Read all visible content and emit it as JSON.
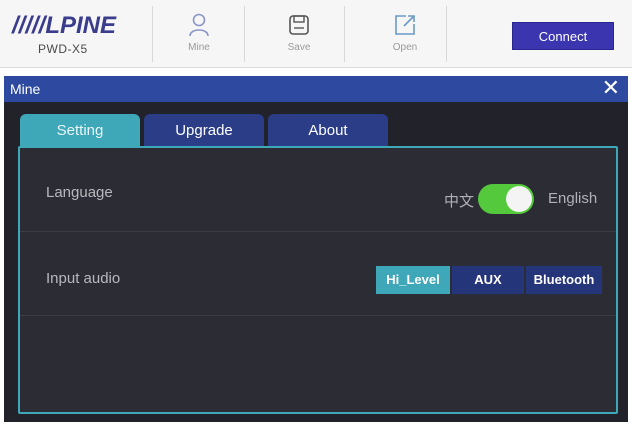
{
  "brand": {
    "logo_text": "/////LPINE",
    "model": "PWD-X5"
  },
  "toolbar": {
    "mine_label": "Mine",
    "save_label": "Save",
    "open_label": "Open",
    "connect_label": "Connect"
  },
  "dialog": {
    "title": "Mine",
    "close_symbol": "✕",
    "tabs": [
      {
        "label": "Setting",
        "active": true
      },
      {
        "label": "Upgrade",
        "active": false
      },
      {
        "label": "About",
        "active": false
      }
    ],
    "settings": {
      "language": {
        "label": "Language",
        "option_left": "中文",
        "option_right": "English",
        "toggle_on": true
      },
      "input_audio": {
        "label": "Input audio",
        "options": [
          "Hi_Level",
          "AUX",
          "Bluetooth"
        ],
        "selected": "Hi_Level"
      }
    }
  },
  "colors": {
    "accent_teal": "#3ea7b8",
    "title_blue": "#2e4aa0",
    "connect_purple": "#3b35b0",
    "toggle_green": "#54c93c"
  },
  "icons": [
    "person-icon",
    "save-icon",
    "open-icon",
    "close-icon"
  ]
}
